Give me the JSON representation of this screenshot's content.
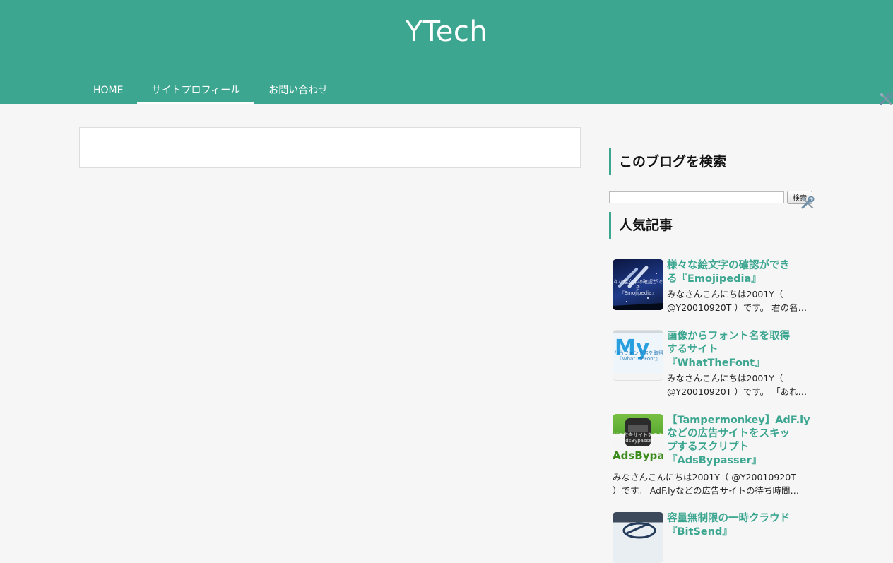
{
  "site": {
    "title": "YTech"
  },
  "nav": {
    "items": [
      {
        "label": "HOME"
      },
      {
        "label": "サイトプロフィール"
      },
      {
        "label": "お問い合わせ"
      }
    ]
  },
  "sidebar": {
    "search_widget": {
      "title": "このブログを検索",
      "placeholder": "",
      "button_label": "検索"
    },
    "popular_widget": {
      "title": "人気記事",
      "posts": [
        {
          "title_lines": [
            "様々な絵文字の確認ができ",
            "る『Emojipedia』"
          ],
          "thumb_caption": [
            "々な絵文字の確認ができ",
            "『Emojipedia』"
          ],
          "excerpt_lines": [
            "みなさんこんにちは2001Y（",
            "@Y20010920T ）です。 君の名…"
          ]
        },
        {
          "title_lines": [
            "画像からフォント名を取得",
            "するサイト",
            "『WhatTheFont』"
          ],
          "thumb_caption": [
            "からフォント名を取得",
            "『WhatTheFont』"
          ],
          "excerpt_lines": [
            "みなさんこんにちは2001Y（",
            "@Y20010920T ）です。 「あれ…"
          ]
        },
        {
          "title_lines": [
            "【Tampermonkey】AdF.ly",
            "などの広告サイトをスキッ",
            "プするスクリプト",
            "『AdsBypasser』"
          ],
          "thumb_caption": [
            "どの広告サイトをスキ",
            "AdsBypasser"
          ],
          "excerpt_lines": [
            "みなさんこんにちは2001Y（ @Y20010920T",
            "）です。 AdF.lyなどの広告サイトの待ち時間…"
          ]
        },
        {
          "title_lines": [
            "容量無制限の一時クラウド",
            "『BitSend』"
          ],
          "thumb_caption": [],
          "excerpt_lines": []
        }
      ]
    }
  },
  "colors": {
    "accent": "#3ca690",
    "background": "#f6f6f6"
  }
}
